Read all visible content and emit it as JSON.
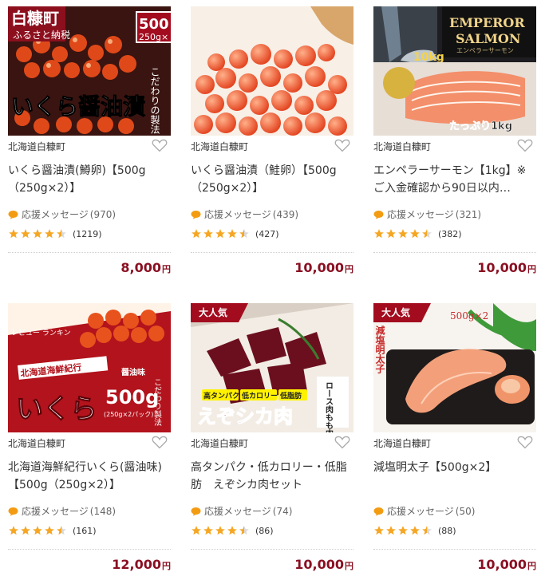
{
  "accent_color": "#a30c1f",
  "star_color": "#f5a623",
  "products": [
    {
      "image_alt": "いくら醤油漬 500g 250g×2 こだわりの製法",
      "image_texts": [
        "白糠町",
        "ふるさと納税",
        "500",
        "250g×",
        "いくら醤油漬",
        "こだわりの製法"
      ],
      "badge": "",
      "town": "北海道白糠町",
      "title": "いくら醤油漬(鱒卵)【500g（250g×2）】",
      "message_label": "応援メッセージ",
      "message_count": "(970)",
      "rating": 4.5,
      "review_count": "(1219)",
      "price": "8,000",
      "currency": "円"
    },
    {
      "image_alt": "いくら醤油漬 鮭卵",
      "image_texts": [],
      "badge": "",
      "town": "北海道白糠町",
      "title": "いくら醤油漬（鮭卵）【500g（250g×2）】",
      "message_label": "応援メッセージ",
      "message_count": "(439)",
      "rating": 4.5,
      "review_count": "(427)",
      "price": "10,000",
      "currency": "円"
    },
    {
      "image_alt": "EMPEROR SALMON",
      "image_texts": [
        "EMPEROR",
        "SALMON",
        "エンペラーサーモン",
        "10kg",
        "たっぷり1kg"
      ],
      "badge": "",
      "town": "北海道白糠町",
      "title": "エンペラーサーモン【1kg】※ご入金確認から90日以内…",
      "message_label": "応援メッセージ",
      "message_count": "(321)",
      "rating": 4.5,
      "review_count": "(382)",
      "price": "10,000",
      "currency": "円"
    },
    {
      "image_alt": "北海道海鮮紀行 いくら 醤油味 500g",
      "image_texts": [
        "北海道海鮮紀行",
        "醤油味",
        "500g",
        "(250g×2パック)",
        "いくら",
        "こだわり製法"
      ],
      "badge": "",
      "town": "北海道白糠町",
      "title": "北海道海鮮紀行いくら(醤油味)【500g（250g×2）】",
      "message_label": "応援メッセージ",
      "message_count": "(148)",
      "rating": 4.5,
      "review_count": "(161)",
      "price": "12,000",
      "currency": "円"
    },
    {
      "image_alt": "えぞシカ肉",
      "image_texts": [
        "高タンパク",
        "低カロリー",
        "低脂肪",
        "えぞシカ肉",
        "ロース肉もも肉セット"
      ],
      "badge": "大人気",
      "town": "北海道白糠町",
      "title": "高タンパク・低カロリー・低脂肪　えぞシカ肉セット",
      "message_label": "応援メッセージ",
      "message_count": "(74)",
      "rating": 4.5,
      "review_count": "(86)",
      "price": "10,000",
      "currency": "円"
    },
    {
      "image_alt": "減塩明太子",
      "image_texts": [
        "500g×2",
        "減塩明太子"
      ],
      "badge": "大人気",
      "town": "北海道白糠町",
      "title": "減塩明太子【500g×2】",
      "message_label": "応援メッセージ",
      "message_count": "(50)",
      "rating": 4.5,
      "review_count": "(88)",
      "price": "10,000",
      "currency": "円"
    }
  ]
}
